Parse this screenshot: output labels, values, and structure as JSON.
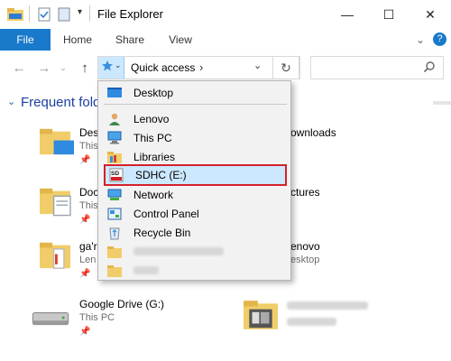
{
  "window": {
    "title": "File Explorer",
    "controls": {
      "minimize": "—",
      "maximize": "☐",
      "close": "✕"
    }
  },
  "ribbon": {
    "tabs": [
      "File",
      "Home",
      "Share",
      "View"
    ],
    "expand_glyph": "⌄",
    "help_glyph": "?"
  },
  "address": {
    "location": "Quick access",
    "separator": "›"
  },
  "content": {
    "section_title": "Frequent fold",
    "items": [
      {
        "name": "Des",
        "sub": "This"
      },
      {
        "name": "ownloads",
        "sub": ""
      },
      {
        "name": "Doc",
        "sub": "This"
      },
      {
        "name": "ctures",
        "sub": ""
      },
      {
        "name": "ga'r",
        "sub": "Len"
      },
      {
        "name": "enovo",
        "sub": "esktop"
      },
      {
        "name": "Google Drive (G:)",
        "sub": "This PC"
      }
    ]
  },
  "dropdown": {
    "items": [
      {
        "label": "Desktop",
        "icon": "desktop-icon"
      },
      {
        "label": "Lenovo",
        "icon": "user-icon"
      },
      {
        "label": "This PC",
        "icon": "computer-icon"
      },
      {
        "label": "Libraries",
        "icon": "libraries-icon"
      },
      {
        "label": "SDHC (E:)",
        "icon": "sd-card-icon",
        "selected": true
      },
      {
        "label": "Network",
        "icon": "network-icon"
      },
      {
        "label": "Control Panel",
        "icon": "control-panel-icon"
      },
      {
        "label": "Recycle Bin",
        "icon": "recycle-bin-icon"
      }
    ]
  },
  "colors": {
    "accent": "#1979ca",
    "selection": "#cce8ff",
    "highlight_border": "#d4202a",
    "folder": "#f1cd6a"
  }
}
